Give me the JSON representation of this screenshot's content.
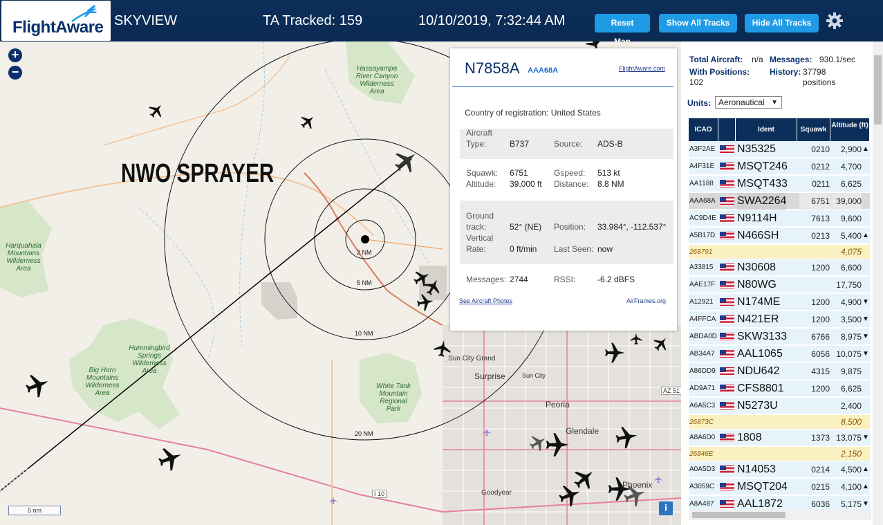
{
  "header": {
    "logo_text": "FlightAware",
    "app_name": "SKYVIEW",
    "tracked": "TA Tracked: 159",
    "datetime": "10/10/2019, 7:32:44 AM",
    "reset_map": "Reset Map",
    "show_tracks": "Show All Tracks",
    "hide_tracks": "Hide All Tracks",
    "settings_icon": "gear-icon"
  },
  "map": {
    "annotation": "NWO SPRAYER",
    "zoom_in": "+",
    "zoom_out": "−",
    "scale": "5 nm",
    "info": "i",
    "rings": [
      "2 NM",
      "5 NM",
      "10 NM",
      "20 NM"
    ],
    "regions": [
      "Hassayampa\nRiver Canyon\nWilderness\nArea",
      "Harquahala\nMountains\nWilderness\nArea",
      "Hummingbird\nSprings\nWilderness\nArea",
      "Big Horn\nMountains\nWilderness\nArea",
      "White Tank\nMountain\nRegional\nPark"
    ],
    "cities": [
      "Sun City Grand",
      "Surprise",
      "Sun City",
      "Peoria",
      "Glendale",
      "Goodyear",
      "Phoenix",
      "I 10",
      "AZ 51"
    ]
  },
  "popup": {
    "registration": "N7858A",
    "icao": "AAA68A",
    "link": "FlightAware.com",
    "country_label": "Country of registration:",
    "country": "United States",
    "aircraft_type_label": "Aircraft\nType:",
    "aircraft_type": "B737",
    "source_label": "Source:",
    "source": "ADS-B",
    "squawk_label": "Squawk:",
    "squawk": "6751",
    "altitude_label": "Altitude:",
    "altitude": "39,000 ft",
    "gspeed_label": "Gspeed:",
    "gspeed": "513 kt",
    "distance_label": "Distance:",
    "distance": "8.8 NM",
    "track_label": "Ground\ntrack:",
    "track": "52° (NE)",
    "position_label": "Position:",
    "position": "33.984°, -112.537°",
    "vrate_label": "Vertical\nRate:",
    "vrate": "0 ft/min",
    "lastseen_label": "Last Seen:",
    "lastseen": "now",
    "messages_label": "Messages:",
    "messages": "2744",
    "rssi_label": "RSSI:",
    "rssi": "-6.2 dBFS",
    "photos_link": "See Aircraft Photos",
    "airframes": "AirFrames.org"
  },
  "sidebar": {
    "total_label": "Total Aircraft:",
    "total": "n/a",
    "messages_label": "Messages:",
    "messages": "930.1/sec",
    "positions_label": "With Positions:",
    "positions": "102",
    "history_label": "History:",
    "history": "37798\npositions",
    "units_label": "Units:",
    "units_value": "Aeronautical",
    "columns": [
      "ICAO",
      "",
      "Ident",
      "Squawk",
      "Altitude (ft)"
    ],
    "rows": [
      {
        "icao": "A3F2AE",
        "ident": "N35325",
        "squawk": "0210",
        "alt": "2,900",
        "trend": "▲",
        "type": "norm"
      },
      {
        "icao": "A4F31E",
        "ident": "MSQT246",
        "squawk": "0212",
        "alt": "4,700",
        "trend": "",
        "type": "norm"
      },
      {
        "icao": "AA1188",
        "ident": "MSQT433",
        "squawk": "0211",
        "alt": "6,625",
        "trend": "",
        "type": "norm"
      },
      {
        "icao": "AAA68A",
        "ident": "SWA2264",
        "squawk": "6751",
        "alt": "39,000",
        "trend": "",
        "type": "sel"
      },
      {
        "icao": "AC9D4E",
        "ident": "N9114H",
        "squawk": "7613",
        "alt": "9,600",
        "trend": "",
        "type": "norm"
      },
      {
        "icao": "A5B17D",
        "ident": "N466SH",
        "squawk": "0213",
        "alt": "5,400",
        "trend": "▲",
        "type": "norm"
      },
      {
        "icao": "268791",
        "ident": "",
        "squawk": "",
        "alt": "4,075",
        "trend": "",
        "type": "mlat"
      },
      {
        "icao": "A33815",
        "ident": "N30608",
        "squawk": "1200",
        "alt": "6,600",
        "trend": "",
        "type": "norm"
      },
      {
        "icao": "AAE17F",
        "ident": "N80WG",
        "squawk": "",
        "alt": "17,750",
        "trend": "",
        "type": "norm"
      },
      {
        "icao": "A12921",
        "ident": "N174ME",
        "squawk": "1200",
        "alt": "4,900",
        "trend": "▼",
        "type": "norm"
      },
      {
        "icao": "A4FFCA",
        "ident": "N421ER",
        "squawk": "1200",
        "alt": "3,500",
        "trend": "▼",
        "type": "norm"
      },
      {
        "icao": "ABDA0D",
        "ident": "SKW3133",
        "squawk": "6766",
        "alt": "8,975",
        "trend": "▼",
        "type": "norm"
      },
      {
        "icao": "AB34A7",
        "ident": "AAL1065",
        "squawk": "6056",
        "alt": "10,075",
        "trend": "▼",
        "type": "norm"
      },
      {
        "icao": "A86DD9",
        "ident": "NDU642",
        "squawk": "4315",
        "alt": "9,875",
        "trend": "",
        "type": "norm"
      },
      {
        "icao": "AD9A71",
        "ident": "CFS8801",
        "squawk": "1200",
        "alt": "6,625",
        "trend": "",
        "type": "norm"
      },
      {
        "icao": "A6A5C3",
        "ident": "N5273U",
        "squawk": "",
        "alt": "2,400",
        "trend": "",
        "type": "norm"
      },
      {
        "icao": "26873C",
        "ident": "",
        "squawk": "",
        "alt": "8,500",
        "trend": "",
        "type": "mlat"
      },
      {
        "icao": "A8A6D0",
        "ident": "1808",
        "squawk": "1373",
        "alt": "13,075",
        "trend": "▼",
        "type": "norm"
      },
      {
        "icao": "26846E",
        "ident": "",
        "squawk": "",
        "alt": "2,150",
        "trend": "",
        "type": "mlat"
      },
      {
        "icao": "A0A5D3",
        "ident": "N14053",
        "squawk": "0214",
        "alt": "4,500",
        "trend": "▲",
        "type": "norm"
      },
      {
        "icao": "A3059C",
        "ident": "MSQT204",
        "squawk": "0215",
        "alt": "4,100",
        "trend": "▲",
        "type": "norm"
      },
      {
        "icao": "A8A487",
        "ident": "AAL1872",
        "squawk": "6036",
        "alt": "5,175",
        "trend": "▼",
        "type": "norm"
      }
    ]
  }
}
